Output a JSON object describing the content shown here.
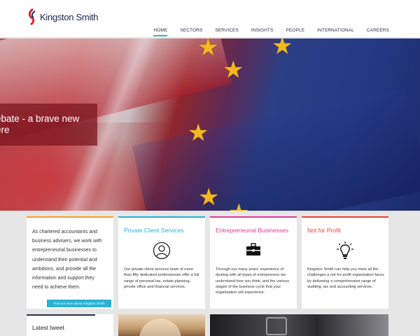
{
  "header": {
    "logo_text": "Kingston Smith",
    "nav": [
      {
        "label": "HOME",
        "active": true
      },
      {
        "label": "SECTORS",
        "active": false
      },
      {
        "label": "SERVICES",
        "active": false
      },
      {
        "label": "INSIGHTS",
        "active": false
      },
      {
        "label": "PEOPLE",
        "active": false
      },
      {
        "label": "INTERNATIONAL",
        "active": false
      },
      {
        "label": "CAREERS",
        "active": false
      }
    ],
    "nav_active_color": "#29b2d6"
  },
  "hero": {
    "caption_line1": "ebate - a brave new",
    "caption_line2": "ere"
  },
  "cards": [
    {
      "accent": "#f39c2a",
      "body": "As chartered accountants and business advisers, we work with entrepreneurial businesses to understand their potential and ambitions, and provide all the information and support they need to achieve them.",
      "button": "Find out more about Kingston Smith"
    },
    {
      "accent": "#29b2d6",
      "title": "Private Client Services",
      "icon": "person-icon",
      "body": "Our private client services team of more than fifty dedicated professionals offer a full range of personal tax, estate planning, private office and financial services."
    },
    {
      "accent": "#e0399a",
      "title": "Entrepreneurial Businesses",
      "icon": "briefcase-icon",
      "body": "Through our many years' experience of dealing with all types of entrepreneur we understand how you think, and the various stages of the business cycle that your organisation will experience."
    },
    {
      "accent": "#e8432f",
      "title": "Not for Profit",
      "icon": "lightbulb-icon",
      "body": "Kingston Smith can help you meet all the challenges a not for profit organisation faces by delivering a comprehensive range of auditing, tax and accounting services."
    }
  ],
  "tweet": {
    "title": "Latest tweet"
  }
}
